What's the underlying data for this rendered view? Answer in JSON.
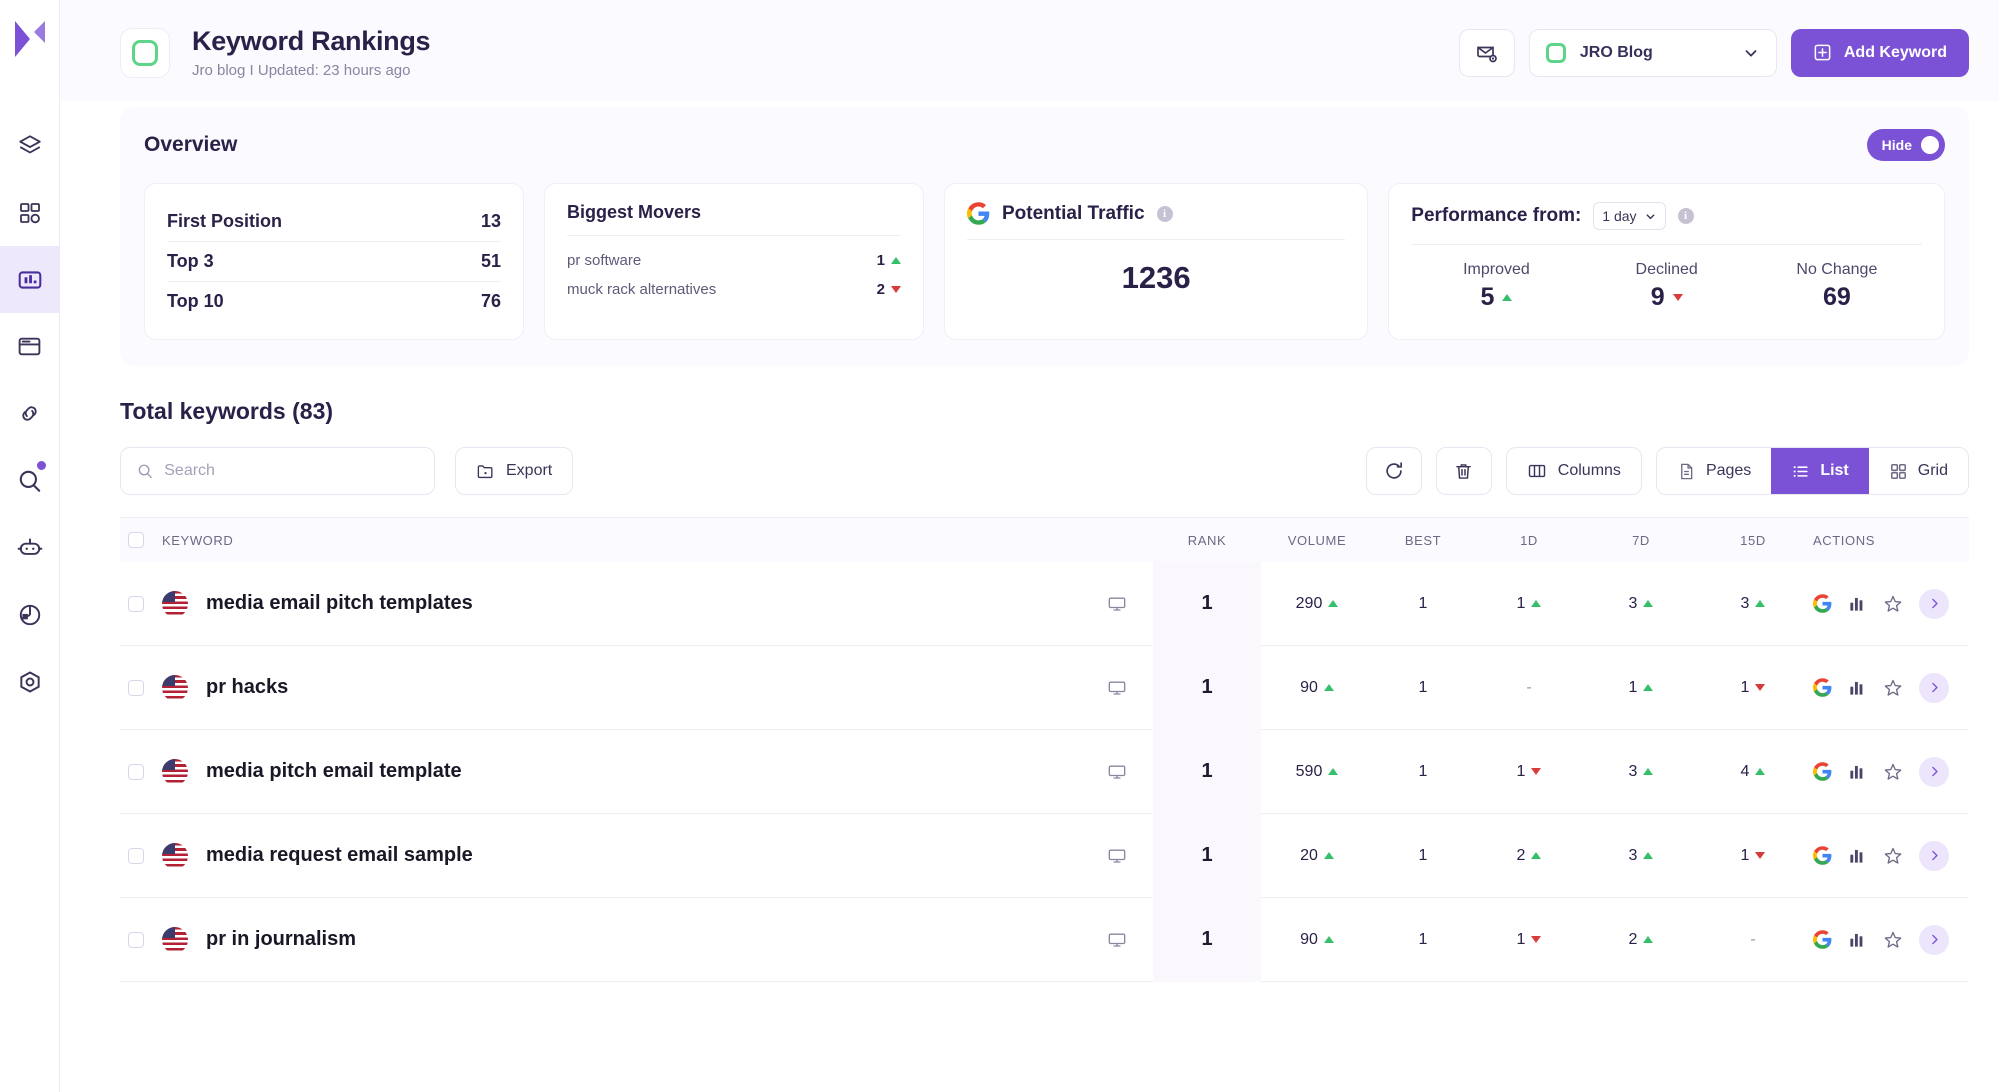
{
  "sidebar": {
    "logo": "logo-icon",
    "items": [
      {
        "name": "layers-icon",
        "active": false,
        "dot": false
      },
      {
        "name": "dashboard-grid-icon",
        "active": false,
        "dot": false
      },
      {
        "name": "bar-chart-icon",
        "active": true,
        "dot": false
      },
      {
        "name": "browser-window-icon",
        "active": false,
        "dot": false
      },
      {
        "name": "link-icon",
        "active": false,
        "dot": false
      },
      {
        "name": "search-icon",
        "active": false,
        "dot": true
      },
      {
        "name": "robot-icon",
        "active": false,
        "dot": false
      },
      {
        "name": "pie-chart-icon",
        "active": false,
        "dot": false
      },
      {
        "name": "target-icon",
        "active": false,
        "dot": false
      }
    ]
  },
  "header": {
    "title": "Keyword Rankings",
    "subtitle": "Jro blog I Updated: 23 hours ago",
    "mail_settings_icon": "mail-settings-icon",
    "site_select": {
      "label": "JRO Blog",
      "chevron": "chevron-down-icon"
    },
    "add_keyword_label": "Add Keyword",
    "add_icon": "plus-square-icon"
  },
  "overview": {
    "title": "Overview",
    "hide_label": "Hide",
    "positions": {
      "rows": [
        {
          "label": "First Position",
          "value": "13"
        },
        {
          "label": "Top 3",
          "value": "51"
        },
        {
          "label": "Top 10",
          "value": "76"
        }
      ]
    },
    "movers": {
      "title": "Biggest Movers",
      "rows": [
        {
          "keyword": "pr software",
          "value": "1",
          "dir": "up"
        },
        {
          "keyword": "muck rack alternatives",
          "value": "2",
          "dir": "down"
        }
      ]
    },
    "potential_traffic": {
      "title": "Potential Traffic",
      "value": "1236",
      "icon": "google-icon",
      "info": "info-icon"
    },
    "performance": {
      "title": "Performance from:",
      "range": "1 day",
      "info": "info-icon",
      "stats": [
        {
          "label": "Improved",
          "value": "5",
          "dir": "up"
        },
        {
          "label": "Declined",
          "value": "9",
          "dir": "down"
        },
        {
          "label": "No Change",
          "value": "69",
          "dir": "none"
        }
      ]
    }
  },
  "keywords_section": {
    "title": "Total keywords (83)",
    "search_placeholder": "Search",
    "search_value": "",
    "export_label": "Export",
    "refresh_icon": "refresh-icon",
    "delete_icon": "trash-icon",
    "columns_label": "Columns",
    "pages_label": "Pages",
    "list_label": "List",
    "grid_label": "Grid",
    "active_view": "List"
  },
  "table": {
    "headers": {
      "keyword": "KEYWORD",
      "rank": "RANK",
      "volume": "VOLUME",
      "best": "BEST",
      "d1": "1D",
      "d7": "7D",
      "d15": "15D",
      "actions": "ACTIONS"
    },
    "rows": [
      {
        "keyword": "media email pitch templates",
        "country": "us-flag",
        "device": "desktop-icon",
        "rank": "1",
        "volume": "290",
        "volume_dir": "up",
        "best": "1",
        "d1": "1",
        "d1_dir": "up",
        "d7": "3",
        "d7_dir": "up",
        "d15": "3",
        "d15_dir": "up"
      },
      {
        "keyword": "pr hacks",
        "country": "us-flag",
        "device": "desktop-icon",
        "rank": "1",
        "volume": "90",
        "volume_dir": "up",
        "best": "1",
        "d1": "-",
        "d1_dir": "none",
        "d7": "1",
        "d7_dir": "up",
        "d15": "1",
        "d15_dir": "down"
      },
      {
        "keyword": "media pitch email template",
        "country": "us-flag",
        "device": "desktop-icon",
        "rank": "1",
        "volume": "590",
        "volume_dir": "up",
        "best": "1",
        "d1": "1",
        "d1_dir": "down",
        "d7": "3",
        "d7_dir": "up",
        "d15": "4",
        "d15_dir": "up"
      },
      {
        "keyword": "media request email sample",
        "country": "us-flag",
        "device": "desktop-icon",
        "rank": "1",
        "volume": "20",
        "volume_dir": "up",
        "best": "1",
        "d1": "2",
        "d1_dir": "up",
        "d7": "3",
        "d7_dir": "up",
        "d15": "1",
        "d15_dir": "down"
      },
      {
        "keyword": "pr in journalism",
        "country": "us-flag",
        "device": "desktop-icon",
        "rank": "1",
        "volume": "90",
        "volume_dir": "up",
        "best": "1",
        "d1": "1",
        "d1_dir": "down",
        "d7": "2",
        "d7_dir": "up",
        "d15": "-",
        "d15_dir": "none"
      }
    ],
    "row_actions": {
      "google_icon": "google-icon",
      "chart_icon": "bar-chart-icon",
      "star_icon": "star-icon",
      "expand_icon": "chevron-right-icon"
    }
  },
  "colors": {
    "accent": "#7b52d6",
    "accent_soft": "#ede8fb",
    "up": "#36c06c",
    "down": "#d93b3b",
    "brand_green": "#5ed48a",
    "page_bg": "#fbfaff",
    "text": "#2b2048"
  }
}
